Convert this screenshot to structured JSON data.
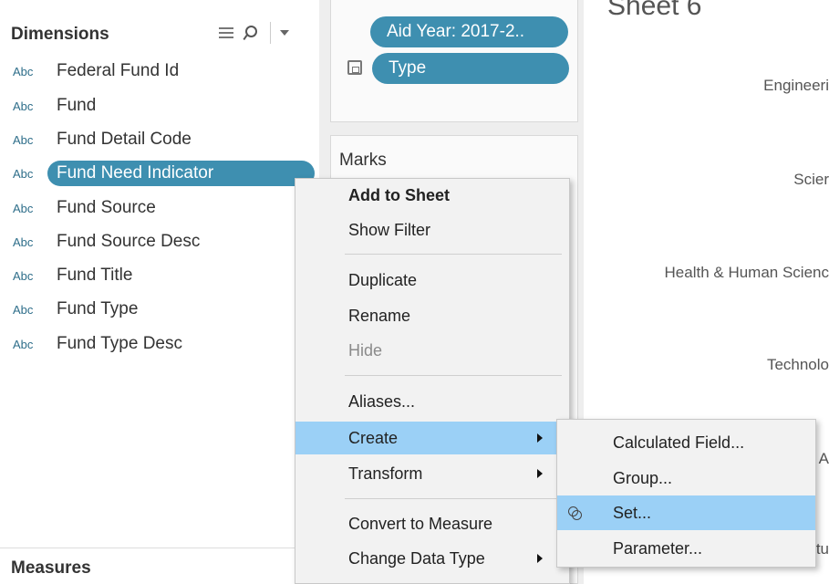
{
  "data_pane": {
    "dimensions_header": "Dimensions",
    "measures_header": "Measures",
    "type_prefix": "Abc",
    "fields": [
      {
        "label": "Federal Fund Id"
      },
      {
        "label": "Fund"
      },
      {
        "label": "Fund Detail Code"
      },
      {
        "label": "Fund Need Indicator"
      },
      {
        "label": "Fund Source"
      },
      {
        "label": "Fund Source Desc"
      },
      {
        "label": "Fund Title"
      },
      {
        "label": "Fund Type"
      },
      {
        "label": "Fund Type Desc"
      }
    ],
    "selected_field": "Fund Need Indicator"
  },
  "shelves": {
    "filters": [
      {
        "label": "Aid Year: 2017-2.."
      },
      {
        "label": "Type"
      }
    ],
    "marks_label": "Marks"
  },
  "sheet": {
    "title": "Sheet 6",
    "row_labels": [
      "Engineeri",
      "Scier",
      "Health & Human Scienc",
      "Technolo",
      "A",
      "tu"
    ]
  },
  "context_menu": {
    "items": [
      {
        "label": "Add to Sheet",
        "style": "bold"
      },
      {
        "label": "Show Filter"
      },
      {
        "label": "Duplicate"
      },
      {
        "label": "Rename"
      },
      {
        "label": "Hide",
        "state": "disabled"
      },
      {
        "label": "Aliases..."
      },
      {
        "label": "Create",
        "state": "highlighted",
        "has_submenu": true
      },
      {
        "label": "Transform",
        "has_submenu": true
      },
      {
        "label": "Convert to Measure"
      },
      {
        "label": "Change Data Type",
        "has_submenu": true
      }
    ]
  },
  "create_submenu": {
    "items": [
      {
        "label": "Calculated Field..."
      },
      {
        "label": "Group..."
      },
      {
        "label": "Set...",
        "state": "highlighted",
        "icon": "set-icon"
      },
      {
        "label": "Parameter..."
      }
    ]
  },
  "colors": {
    "pill_blue": "#3e8fb0",
    "menu_highlight": "#9bd0f6",
    "menu_bg": "#f2f2f2",
    "abc_teal": "#2e6e8a"
  }
}
